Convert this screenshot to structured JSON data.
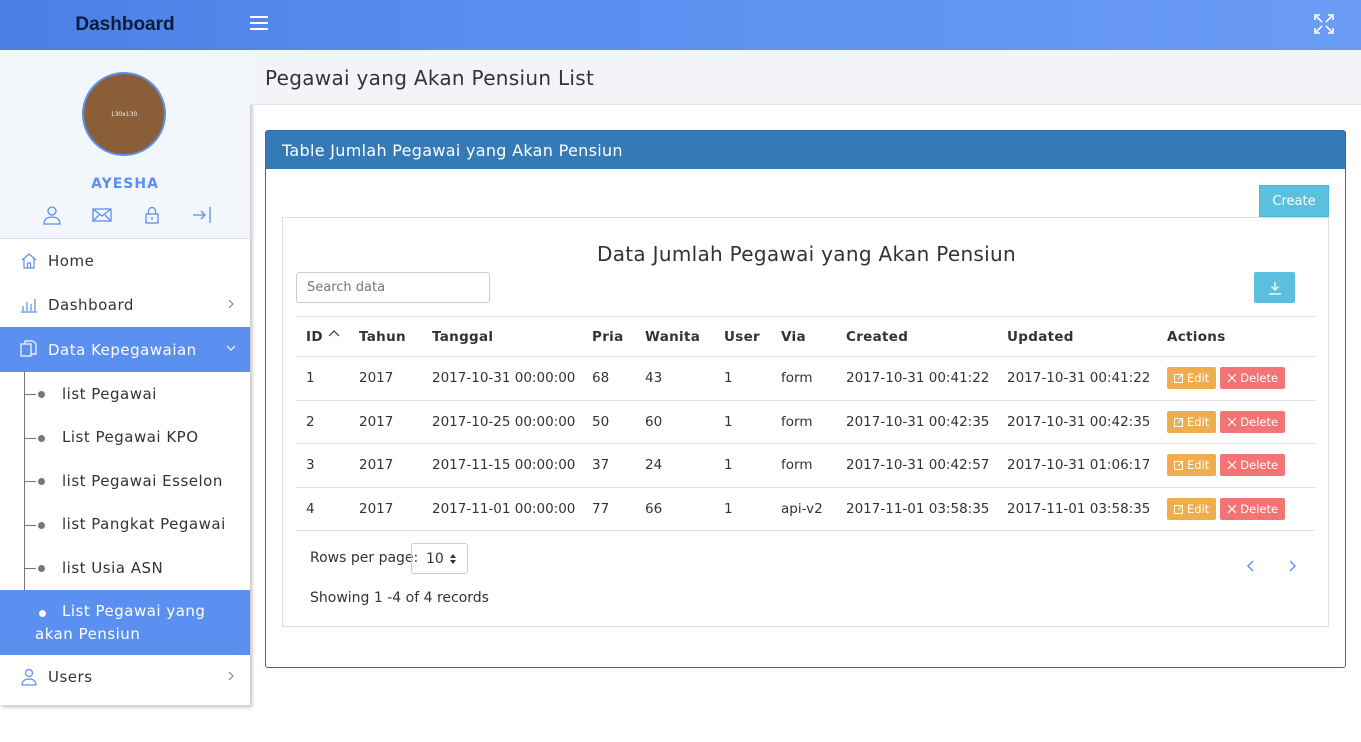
{
  "app": {
    "brand": "Dashboard"
  },
  "profile": {
    "username": "AYESHA",
    "avatar_text": "130x130"
  },
  "sidebar": {
    "items": [
      {
        "label": "Home",
        "icon": "home-icon"
      },
      {
        "label": "Dashboard",
        "icon": "bar-chart-icon"
      },
      {
        "label": "Data Kepegawaian",
        "icon": "copy-icon"
      }
    ],
    "subitems": [
      {
        "label": "list Pegawai"
      },
      {
        "label": "List Pegawai KPO"
      },
      {
        "label": "list Pegawai Esselon"
      },
      {
        "label": "list Pangkat Pegawai"
      },
      {
        "label": "list Usia ASN"
      },
      {
        "label": "List Pegawai yang akan Pensiun"
      }
    ],
    "users": {
      "label": "Users",
      "icon": "user-icon"
    }
  },
  "page": {
    "title": "Pegawai yang Akan Pensiun List"
  },
  "card": {
    "header": "Table Jumlah Pegawai yang Akan Pensiun",
    "create_label": "Create",
    "table_title": "Data Jumlah Pegawai yang Akan Pensiun",
    "search_placeholder": "Search data"
  },
  "table": {
    "columns": [
      "ID",
      "Tahun",
      "Tanggal",
      "Pria",
      "Wanita",
      "User",
      "Via",
      "Created",
      "Updated",
      "Actions"
    ],
    "rows": [
      [
        "1",
        "2017",
        "2017-10-31 00:00:00",
        "68",
        "43",
        "1",
        "form",
        "2017-10-31 00:41:22",
        "2017-10-31 00:41:22"
      ],
      [
        "2",
        "2017",
        "2017-10-25 00:00:00",
        "50",
        "60",
        "1",
        "form",
        "2017-10-31 00:42:35",
        "2017-10-31 00:42:35"
      ],
      [
        "3",
        "2017",
        "2017-11-15 00:00:00",
        "37",
        "24",
        "1",
        "form",
        "2017-10-31 00:42:57",
        "2017-10-31 01:06:17"
      ],
      [
        "4",
        "2017",
        "2017-11-01 00:00:00",
        "77",
        "66",
        "1",
        "api-v2",
        "2017-11-01 03:58:35",
        "2017-11-01 03:58:35"
      ]
    ],
    "edit_label": "Edit",
    "delete_label": "Delete"
  },
  "pagination": {
    "rows_per_page_label": "Rows per page:",
    "rows_per_page_value": "10",
    "showing": "Showing 1 -4 of 4 records"
  },
  "colors": {
    "accent": "#5b8ff0",
    "card_header": "#337ab7",
    "info": "#5bc0de",
    "warning": "#f0ad4e",
    "danger": "#f27474"
  }
}
